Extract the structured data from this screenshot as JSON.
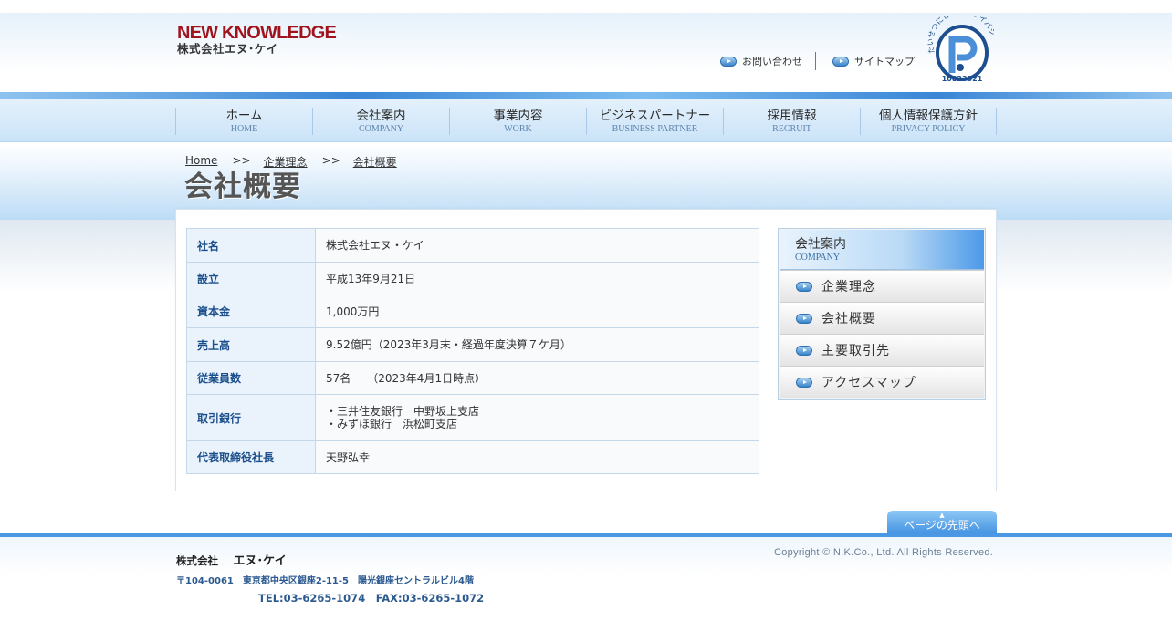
{
  "header": {
    "logo_en": "NEW KNOWLEDGE",
    "logo_jp": "株式会社エヌ･ケイ",
    "links": [
      "お問い合わせ",
      "サイトマップ"
    ],
    "privacy_mark": {
      "arc_text": "たいせつにしますプライバシー",
      "number": "10823321"
    }
  },
  "nav": [
    {
      "jp": "ホーム",
      "en": "HOME"
    },
    {
      "jp": "会社案内",
      "en": "COMPANY"
    },
    {
      "jp": "事業内容",
      "en": "WORK"
    },
    {
      "jp": "ビジネスパートナー",
      "en": "BUSINESS PARTNER"
    },
    {
      "jp": "採用情報",
      "en": "RECRUIT"
    },
    {
      "jp": "個人情報保護方針",
      "en": "PRIVACY POLICY"
    }
  ],
  "breadcrumb": {
    "items": [
      "Home",
      "企業理念",
      "会社概要"
    ],
    "separator": ">>"
  },
  "page_title": "会社概要",
  "company_table": [
    {
      "label": "社名",
      "value": "株式会社エヌ・ケイ"
    },
    {
      "label": "設立",
      "value": "平成13年9月21日"
    },
    {
      "label": "資本金",
      "value": "1,000万円"
    },
    {
      "label": "売上高",
      "value": "9.52億円（2023年3月末・経過年度決算７ケ月）"
    },
    {
      "label": "従業員数",
      "value": "57名　　（2023年4月1日時点）"
    },
    {
      "label": "取引銀行",
      "value": "・三井住友銀行　中野坂上支店",
      "value2": "・みずほ銀行　浜松町支店"
    },
    {
      "label": "代表取締役社長",
      "value": "天野弘幸"
    }
  ],
  "side_menu": {
    "title_jp": "会社案内",
    "title_en": "COMPANY",
    "items": [
      "企業理念",
      "会社概要",
      "主要取引先",
      "アクセスマップ"
    ]
  },
  "page_top": {
    "label": "ページの先頭へ",
    "arrow": "▲"
  },
  "footer": {
    "company_prefix": "株式会社",
    "company_name": "エヌ･ケイ",
    "address": "〒104-0061　東京都中央区銀座2-11-5　陽光銀座セントラルビル4階",
    "tel": "TEL:03-6265-1074　FAX:03-6265-1072",
    "copyright": "Copyright  ©  N.K.Co., Ltd. All Rights Reserved."
  },
  "colors": {
    "logo_red": "#a0141e",
    "accent_blue": "#4a98e4",
    "label_blue": "#1b4f8c"
  }
}
